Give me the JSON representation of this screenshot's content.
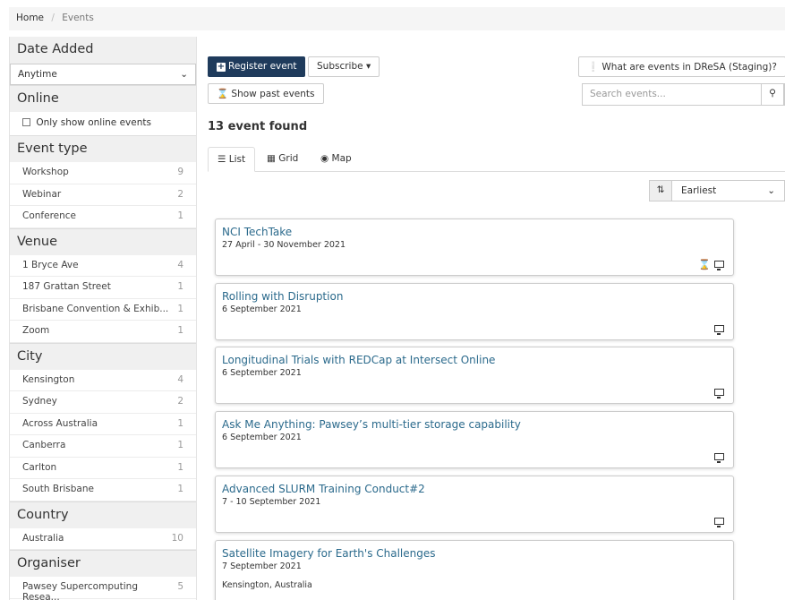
{
  "breadcrumb": {
    "home": "Home",
    "separator": "/",
    "current": "Events"
  },
  "sidebar": {
    "date_added": {
      "heading": "Date Added",
      "selected": "Anytime"
    },
    "online": {
      "heading": "Online",
      "checkbox_label": "Only show online events"
    },
    "event_type": {
      "heading": "Event type",
      "items": [
        {
          "label": "Workshop",
          "count": "9"
        },
        {
          "label": "Webinar",
          "count": "2"
        },
        {
          "label": "Conference",
          "count": "1"
        }
      ]
    },
    "venue": {
      "heading": "Venue",
      "items": [
        {
          "label": "1 Bryce Ave",
          "count": "4"
        },
        {
          "label": "187 Grattan Street",
          "count": "1"
        },
        {
          "label": "Brisbane Convention & Exhib...",
          "count": "1"
        },
        {
          "label": "Zoom",
          "count": "1"
        }
      ]
    },
    "city": {
      "heading": "City",
      "items": [
        {
          "label": "Kensington",
          "count": "4"
        },
        {
          "label": "Sydney",
          "count": "2"
        },
        {
          "label": "Across Australia",
          "count": "1"
        },
        {
          "label": "Canberra",
          "count": "1"
        },
        {
          "label": "Carlton",
          "count": "1"
        },
        {
          "label": "South Brisbane",
          "count": "1"
        }
      ]
    },
    "country": {
      "heading": "Country",
      "items": [
        {
          "label": "Australia",
          "count": "10"
        }
      ]
    },
    "organiser": {
      "heading": "Organiser",
      "items": [
        {
          "label": "Pawsey Supercomputing Resea...",
          "count": "5"
        }
      ]
    }
  },
  "toolbar": {
    "register_label": "Register event",
    "subscribe_label": "Subscribe",
    "what_label": "What are events in DReSA (Staging)?",
    "past_label": "Show past events",
    "search_placeholder": "Search events..."
  },
  "results": {
    "found_text": "13 event found"
  },
  "tabs": [
    {
      "label": "List"
    },
    {
      "label": "Grid"
    },
    {
      "label": "Map"
    }
  ],
  "sort": {
    "selected": "Earliest"
  },
  "events": [
    {
      "title": "NCI TechTake",
      "date": "27 April - 30 November 2021"
    },
    {
      "title": "Rolling with Disruption",
      "date": "6 September 2021"
    },
    {
      "title": "Longitudinal Trials with REDCap at Intersect Online",
      "date": "6 September 2021"
    },
    {
      "title": "Ask Me Anything: Pawsey’s multi-tier storage capability",
      "date": "6 September 2021"
    },
    {
      "title": "Advanced SLURM Training Conduct#2",
      "date": "7 - 10 September 2021"
    },
    {
      "title": "Satellite Imagery for Earth's Challenges",
      "date": "7 September 2021",
      "location": "Kensington, Australia"
    }
  ],
  "colors": {
    "primary": "#1f3b5c",
    "link": "#2b6a8c",
    "facet_bg": "#f0f0f0"
  }
}
